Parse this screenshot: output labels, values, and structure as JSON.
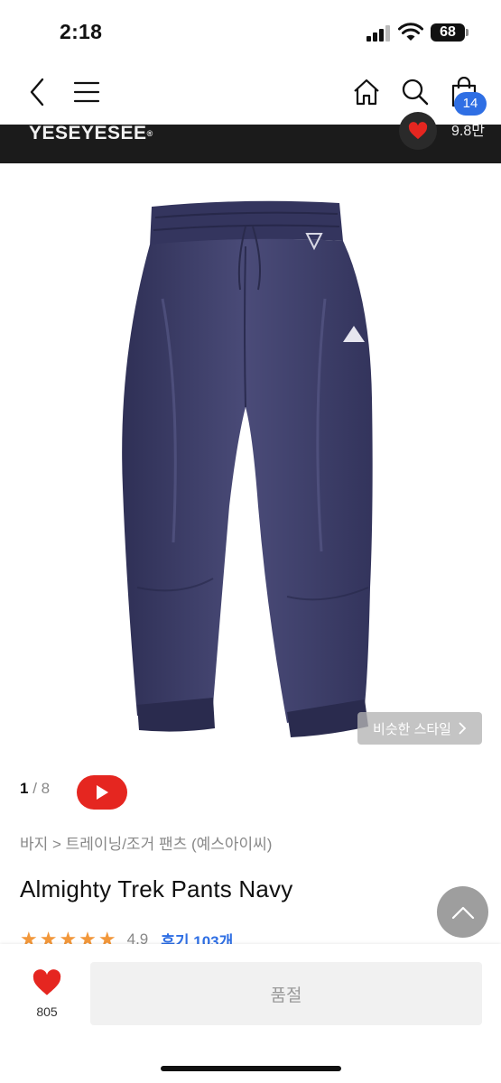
{
  "status": {
    "time": "2:18",
    "battery": "68"
  },
  "nav": {
    "cart_count": "14"
  },
  "brand": {
    "name": "YESEYESEE",
    "mark": "®",
    "likes": "9.8만"
  },
  "gallery": {
    "current": "1",
    "separator": " / ",
    "total": "8",
    "similar_label": "비슷한 스타일"
  },
  "product": {
    "breadcrumb": "바지 > 트레이닝/조거 팬츠 (예스아이씨)",
    "title": "Almighty Trek Pants Navy",
    "stars": "★★★★★",
    "rating": "4.9",
    "reviews": "후기 103개"
  },
  "bottom": {
    "like_count": "805",
    "action_label": "품절"
  },
  "colors": {
    "accent": "#2f6fe4",
    "heart": "#e52620",
    "star": "#f2973a",
    "navy": "#3b3c64"
  },
  "icons": [
    "back-icon",
    "menu-icon",
    "home-icon",
    "search-icon",
    "cart-icon",
    "heart-icon",
    "play-icon",
    "chevron-right-icon",
    "chevron-up-icon"
  ]
}
